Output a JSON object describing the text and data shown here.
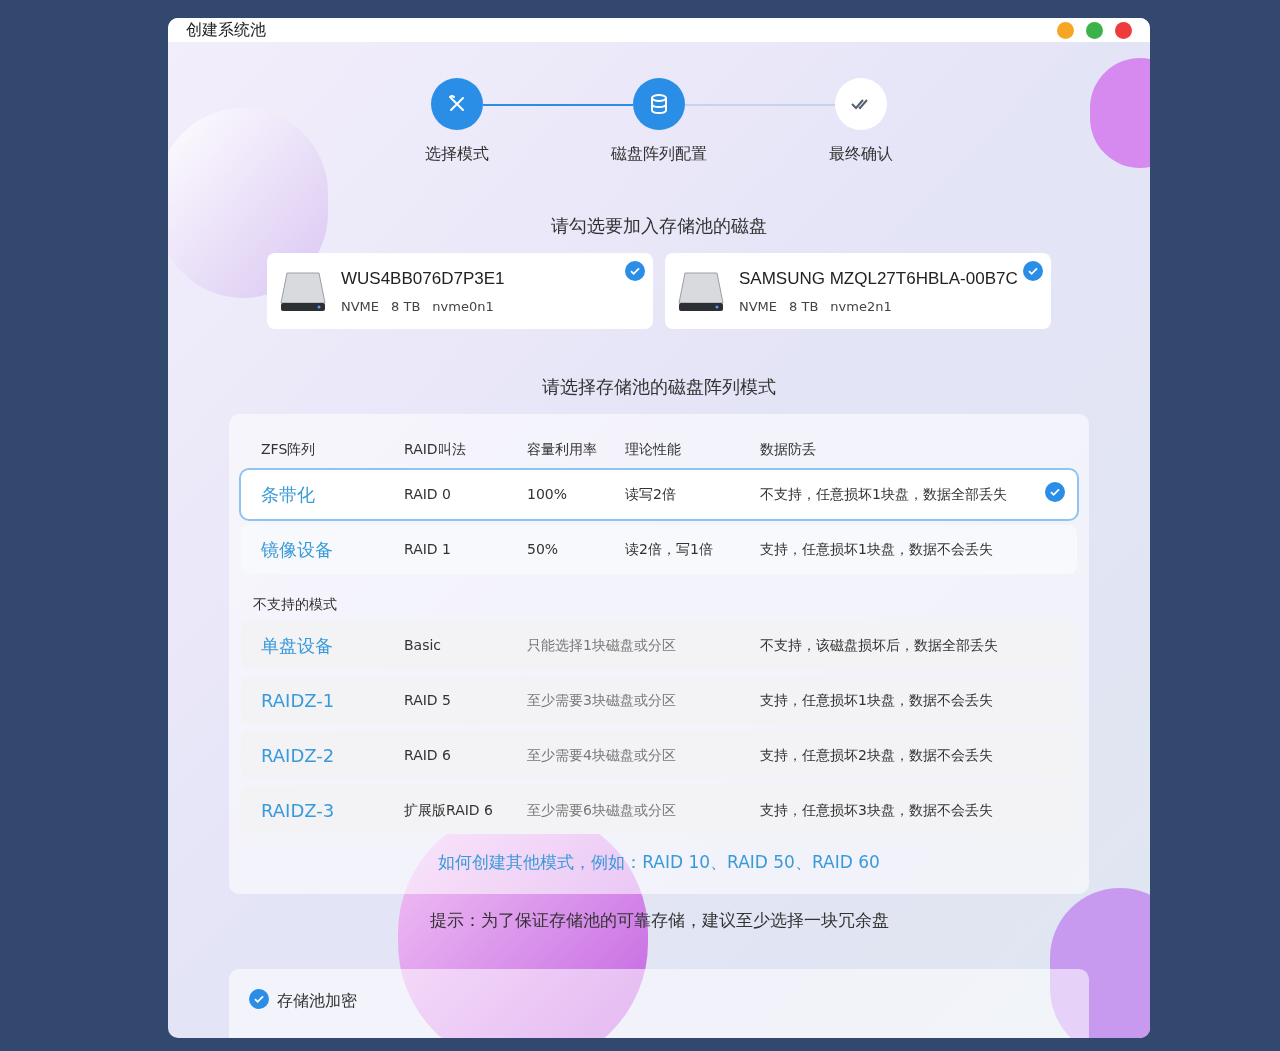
{
  "window": {
    "title": "创建系统池"
  },
  "steps": [
    {
      "label": "选择模式",
      "kind": "tools",
      "done": true
    },
    {
      "label": "磁盘阵列配置",
      "kind": "database",
      "done": true
    },
    {
      "label": "最终确认",
      "kind": "check",
      "done": false
    }
  ],
  "disk_prompt": "请勾选要加入存储池的磁盘",
  "disks": [
    {
      "name": "WUS4BB076D7P3E1",
      "type": "NVME",
      "size": "8 TB",
      "device": "nvme0n1",
      "checked": true
    },
    {
      "name": "SAMSUNG MZQL27T6HBLA-00B7C",
      "type": "NVME",
      "size": "8 TB",
      "device": "nvme2n1",
      "checked": true
    }
  ],
  "mode_prompt": "请选择存储池的磁盘阵列模式",
  "table": {
    "columns": [
      "ZFS阵列",
      "RAID叫法",
      "容量利用率",
      "理论性能",
      "数据防丢"
    ],
    "rows": [
      {
        "name": "条带化",
        "raid": "RAID 0",
        "capacity": "100%",
        "performance": "读写2倍",
        "protection": "不支持，任意损坏1块盘，数据全部丢失",
        "selected": true
      },
      {
        "name": "镜像设备",
        "raid": "RAID 1",
        "capacity": "50%",
        "performance": "读2倍，写1倍",
        "protection": "支持，任意损坏1块盘，数据不会丢失",
        "selected": false
      }
    ],
    "unsupported_heading": "不支持的模式",
    "unsupported_rows": [
      {
        "name": "单盘设备",
        "raid": "Basic",
        "requirement": "只能选择1块磁盘或分区",
        "protection": "不支持，该磁盘损坏后，数据全部丢失"
      },
      {
        "name": "RAIDZ-1",
        "raid": "RAID 5",
        "requirement": "至少需要3块磁盘或分区",
        "protection": "支持，任意损坏1块盘，数据不会丢失"
      },
      {
        "name": "RAIDZ-2",
        "raid": "RAID 6",
        "requirement": "至少需要4块磁盘或分区",
        "protection": "支持，任意损坏2块盘，数据不会丢失"
      },
      {
        "name": "RAIDZ-3",
        "raid": "扩展版RAID 6",
        "requirement": "至少需要6块磁盘或分区",
        "protection": "支持，任意损坏3块盘，数据不会丢失"
      }
    ],
    "help_link": "如何创建其他模式，例如：RAID 10、RAID 50、RAID 60"
  },
  "hint": "提示：为了保证存储池的可靠存储，建议至少选择一块冗余盘",
  "encryption": {
    "label": "存储池加密",
    "checked": true
  }
}
